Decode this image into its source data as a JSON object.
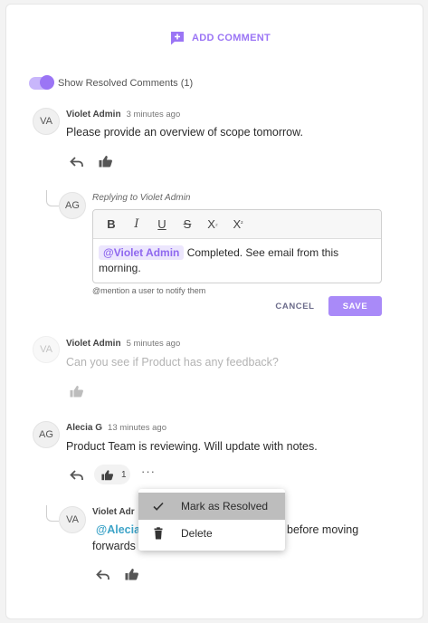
{
  "header": {
    "add_comment_label": "ADD COMMENT"
  },
  "toggle": {
    "label": "Show Resolved Comments (1)",
    "on": true
  },
  "comments": [
    {
      "initials": "VA",
      "author": "Violet Admin",
      "time": "3 minutes ago",
      "text": "Please provide an overview of scope tomorrow."
    },
    {
      "initials": "VA",
      "author": "Violet Admin",
      "time": "5 minutes ago",
      "text": "Can you see if Product has any feedback?",
      "resolved": true
    },
    {
      "initials": "AG",
      "author": "Alecia G",
      "time": "13 minutes ago",
      "text": "Product Team is reviewing. Will update with notes.",
      "likes": "1"
    }
  ],
  "reply_editor": {
    "initials": "AG",
    "replying_to": "Replying to Violet Admin",
    "toolbar": {
      "bold": "B",
      "italic": "I",
      "underline": "U",
      "strike": "S",
      "subscript": "X",
      "subscript_mark": "₂",
      "superscript": "X",
      "superscript_mark": "²"
    },
    "mention": "@Violet Admin",
    "text_line1": " Completed. See email from this",
    "text_line2": "morning.",
    "hint": "@mention a user to notify them",
    "cancel_label": "CANCEL",
    "save_label": "SAVE"
  },
  "nested_reply": {
    "initials": "VA",
    "author": "Violet Adr",
    "mention": "@Alecia",
    "text_tail": "before moving",
    "text_line2": "forwards"
  },
  "context_menu": {
    "items": [
      {
        "label": "Mark as Resolved",
        "icon": "check-icon",
        "active": true
      },
      {
        "label": "Delete",
        "icon": "trash-icon",
        "active": false
      }
    ]
  },
  "colors": {
    "accent": "#9b75f5",
    "save_button": "#a98af8",
    "mention_link": "#3ea4c8",
    "menu_active": "#bdbdbd"
  }
}
